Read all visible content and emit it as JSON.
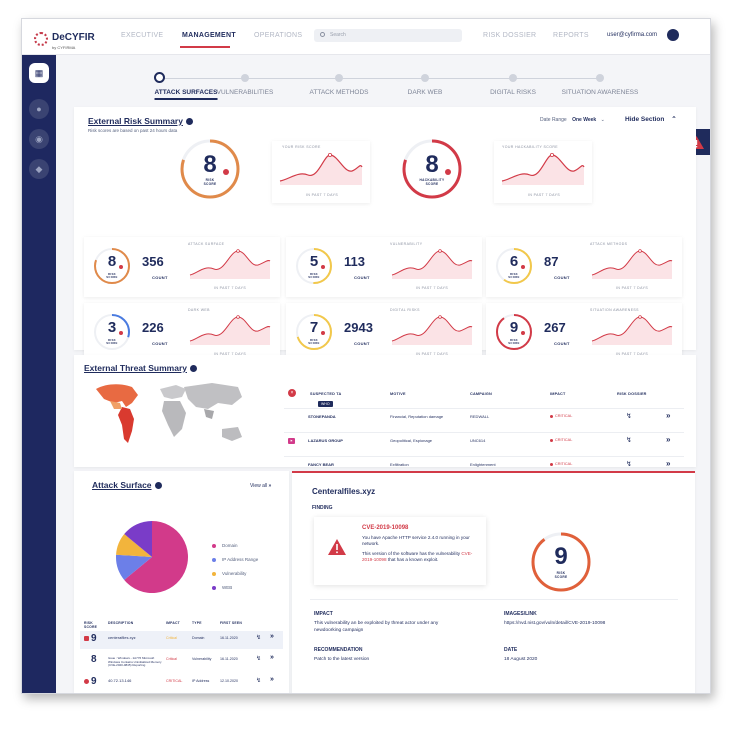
{
  "brand": {
    "name": "DeCYFIR",
    "sub": "by CYFIRMA"
  },
  "nav": {
    "items": [
      "EXECUTIVE",
      "MANAGEMENT",
      "OPERATIONS",
      "RISK DOSSIER",
      "REPORTS"
    ],
    "active": "MANAGEMENT"
  },
  "search": {
    "placeholder": "Search"
  },
  "user": {
    "email": "user@cyfirma.com"
  },
  "sidebar": {
    "icons": [
      "dashboard-icon",
      "person-icon",
      "eye-icon",
      "shield-icon"
    ]
  },
  "steps": [
    "ATTACK SURFACES",
    "VULNERABILITIES",
    "ATTACK METHODS",
    "DARK WEB",
    "DIGITAL RISKS",
    "SITUATION AWARENESS"
  ],
  "risk_summary": {
    "title": "External Risk Summary",
    "subtitle": "Risk scores are based on past 24 hours data",
    "date_range_label": "Date Range",
    "date_range_value": "One Week",
    "hide_label": "Hide Section",
    "risk_score": {
      "value": "8",
      "label": "RISK SCORE"
    },
    "your_risk_title": "YOUR RISK SCORE",
    "hack_score": {
      "value": "8",
      "label": "HACKABILITY SCORE"
    },
    "your_hack_title": "YOUR HACKABILITY SCORE",
    "past_label": "IN PAST 7 DAYS",
    "tiles": [
      {
        "title": "ATTACK SURFACE",
        "score": "8",
        "count": "356",
        "count_label": "COUNT",
        "color": "#e08a4a"
      },
      {
        "title": "VULNERABILITY",
        "score": "5",
        "count": "113",
        "count_label": "COUNT",
        "color": "#f2c84b"
      },
      {
        "title": "ATTACK METHODS",
        "score": "6",
        "count": "87",
        "count_label": "COUNT",
        "color": "#f2c84b"
      },
      {
        "title": "DARK WEB",
        "score": "3",
        "count": "226",
        "count_label": "COUNT",
        "color": "#4a7be0"
      },
      {
        "title": "DIGITAL RISKS",
        "score": "7",
        "count": "2943",
        "count_label": "COUNT",
        "color": "#f2c84b"
      },
      {
        "title": "SITUATION AWARENESS",
        "score": "9",
        "count": "267",
        "count_label": "COUNT",
        "color": "#d23a47"
      }
    ],
    "tile_score_label": "RISK SCORE"
  },
  "threat_summary": {
    "title": "External Threat Summary",
    "headers": [
      "SUSPECTED TA",
      "MOTIVE",
      "CAMPAIGN",
      "IMPACT",
      "RISK DOSSIER"
    ],
    "who_badge": "WHO",
    "rows": [
      {
        "ta": "STONEPANDA",
        "motive": "Financial, Reputation damage",
        "campaign": "REDWALL",
        "impact": "CRITICAL"
      },
      {
        "ta": "LAZARUS GROUP",
        "motive": "Geopolitical, Espionage",
        "campaign": "UNC614",
        "impact": "CRITICAL"
      },
      {
        "ta": "FANCY BEAR",
        "motive": "Exfiltration",
        "campaign": "Enlightenment",
        "impact": "CRITICAL"
      }
    ]
  },
  "attack_surface": {
    "title": "Attack Surface",
    "view_all": "View all",
    "legend": [
      {
        "label": "Domain",
        "color": "#d23a8a"
      },
      {
        "label": "IP Address Range",
        "color": "#6c7fe8"
      },
      {
        "label": "Vulnerability",
        "color": "#f2b43c"
      },
      {
        "label": "WEB",
        "color": "#7a3cc8"
      }
    ],
    "pie": [
      {
        "label": "Domain",
        "value": 64,
        "color": "#d23a8a"
      },
      {
        "label": "IP Address Range",
        "value": 12,
        "color": "#6c7fe8"
      },
      {
        "label": "Vulnerability",
        "value": 10,
        "color": "#f2b43c"
      },
      {
        "label": "WEB",
        "value": 14,
        "color": "#7a3cc8"
      }
    ],
    "headers": [
      "RISK SCORE",
      "DESCRIPTION",
      "IMPACT",
      "TYPE",
      "FIRST SEEN"
    ],
    "rows": [
      {
        "score": "9",
        "desc": "centerafiles.xyz",
        "impact": "Critical",
        "impact_color": "#f2b43c",
        "type": "Domain",
        "seen": "16.11.2020"
      },
      {
        "score": "8",
        "desc": "Issue : Windows - 1A776 Microsoft Windows Contains Uninitialized Memory (CVE-2020-0845) Reporting",
        "impact": "Critical",
        "impact_color": "#d23a47",
        "type": "Vulnerability",
        "seen": "16.11.2020"
      },
      {
        "score": "9",
        "desc": "40.72.13.146",
        "impact": "CRITICAL",
        "impact_color": "#d23a47",
        "type": "IP Address",
        "seen": "12.10.2020"
      }
    ]
  },
  "detail": {
    "domain": "Centeralfiles.xyz",
    "finding_label": "FINDING",
    "cve": "CVE-2019-10098",
    "text1": "You have Apache HTTP service 2.4.0 running in your network.",
    "text2a": "This version of the software has the vulnerability",
    "text2b": "that has a known exploit.",
    "score": "9",
    "score_label": "RISK SCORE",
    "impact_label": "IMPACT",
    "impact_text": "This vulnerability an be exploited by threat actor under any newdoorking campaign",
    "images_label": "IMAGES/LINK",
    "images_link": "https://nvd.nist.gov/vuln/detail/CVE-2019-10098",
    "recommendation_label": "RECOMMENDATION",
    "recommendation_text": "Patch to the latest version",
    "date_label": "DATE",
    "date_value": "18 August 2020"
  }
}
